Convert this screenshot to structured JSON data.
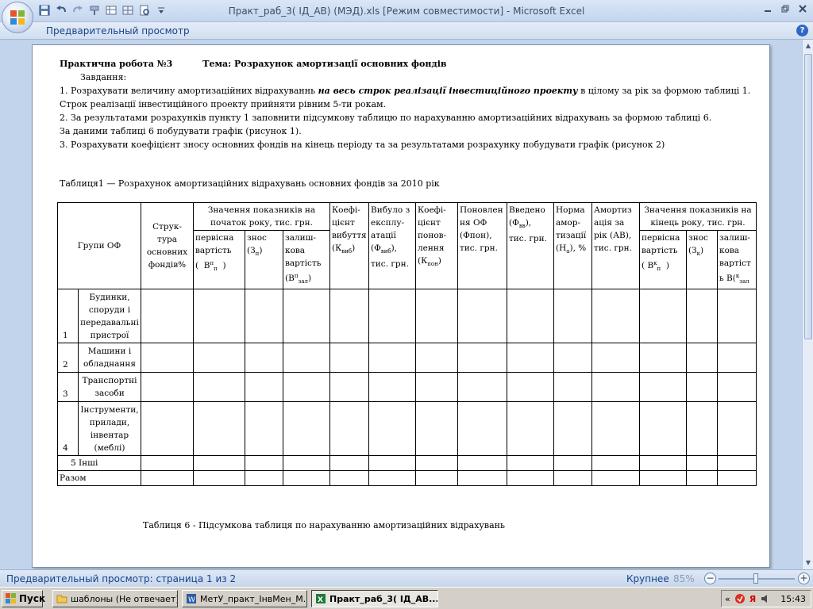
{
  "window": {
    "title": "Практ_раб_3( ІД_АВ) (МЭД).xls  [Режим совместимости] - Microsoft Excel",
    "controls": [
      "minimize",
      "restore",
      "close"
    ]
  },
  "ribbon": {
    "tab": "Предварительный просмотр",
    "help": "?"
  },
  "document": {
    "header_title": "Практична робота №3",
    "header_theme": "Тема: Розрахунок амортизації основних фондів",
    "task_label": "Завдання:",
    "line1_a": "1. Розрахувати величину амортизаційних відрахуваннь ",
    "line1_em": "на весь строк реалізації інвестиційного проекту",
    "line1_b": "  в цілому за рік за формою таблиці 1.",
    "line2": "Строк реалізації інвестиційного проекту прийняти рівним 5-ти рокам.",
    "line3": "2. За результатами розрахунків пункту 1  заповнити підсумкову таблицю по нарахуванню амортизаційних відрахувань за формою таблиці 6.",
    "line4": "За   даними таблиці 6  побудувати графік (рисунок 1).",
    "line5": "3. Розрахувати коефіцієнт зносу основних фондів на кінець періоду та за результатами розрахунку побудувати графік (рисунок 2)",
    "table1_caption": "Таблиця1 — Розрахунок амортизаційних відрахувань основних фондів за 2010 рік",
    "table6_caption": "Таблиця 6 - Підсумкова таблиця по нарахуванню амортизаційних відрахувань"
  },
  "table": {
    "groups_header": "Групи ОФ",
    "structure_header": [
      "Струк-",
      "тура",
      "основних",
      "фондів%"
    ],
    "start_group": [
      "Значення показників на",
      "початок року, тис. грн."
    ],
    "start_initial": [
      "первісна",
      "вартість"
    ],
    "start_initial_sym": "В",
    "start_wear": "знос",
    "start_wear_sym": "З",
    "start_wear_sub": "п",
    "start_residual": [
      "залиш-",
      "кова",
      "вартість"
    ],
    "start_residual_sym": "В",
    "start_residual_sub": "зал",
    "coef_retire": [
      "Коефі-",
      "цієнт",
      "вибуття"
    ],
    "coef_retire_sym": "К",
    "coef_retire_sub": "виб",
    "retired": [
      "Вибуло з",
      "експлу-",
      "атації"
    ],
    "retired_sym": "Ф",
    "retired_sub": "виб",
    "retired_unit": "тис. грн.",
    "coef_renew": [
      "Коефі-",
      "цієнт",
      "понов-",
      "лення"
    ],
    "coef_renew_sym": "К",
    "coef_renew_sub": "пон",
    "renewal": [
      "Поновлен",
      "ня ОФ",
      "(Фпон),",
      "тис. грн."
    ],
    "introduced": "Введено",
    "introduced_sym": "Ф",
    "introduced_sub": "вв",
    "introduced_unit": "тис. грн.",
    "norm": [
      "Норма",
      "амор-",
      "тизації"
    ],
    "norm_sym": "Н",
    "norm_sub": "а",
    "norm_unit": ", %",
    "amort": [
      "Амортиз",
      "ація за",
      "рік (АВ),",
      "тис. грн."
    ],
    "end_group": [
      "Значення показників на",
      "кінець року, тис. грн."
    ],
    "end_initial": [
      "первісна",
      "вартість"
    ],
    "end_initial_sym": "В",
    "end_wear": "знос",
    "end_wear_sym": "З",
    "end_wear_sub": "к",
    "end_residual": [
      "залиш-",
      "кова",
      "вартіст",
      "ь В"
    ],
    "end_residual_sub": "зал",
    "sup_p": "п",
    "sub_p": "п",
    "sup_k": "к",
    "rows": [
      {
        "num": "1",
        "label": [
          "Будинки,",
          "споруди і",
          "передавальні",
          "пристрої"
        ]
      },
      {
        "num": "2",
        "label": [
          "Машини і",
          "обладнання"
        ]
      },
      {
        "num": "3",
        "label": [
          "Транспортні",
          "засоби"
        ]
      },
      {
        "num": "4",
        "label": [
          "Інструменти,",
          "прилади,",
          "інвентар",
          "(меблі)"
        ]
      }
    ],
    "row5_num": "5",
    "row5_label": "Інші",
    "total_label": "Разом"
  },
  "status": {
    "text": "Предварительный просмотр: страница 1 из 2",
    "zoom_label": "Крупнее",
    "zoom_pct": "85%",
    "zoom_level": 0.5
  },
  "taskbar": {
    "start": "Пуск",
    "tasks": [
      "шаблоны (Не отвечает)",
      "МетУ_практ_ІнвМен_М...",
      "Практ_раб_3( ІД_АВ..."
    ],
    "clock": "15:43",
    "lang": "Я"
  }
}
